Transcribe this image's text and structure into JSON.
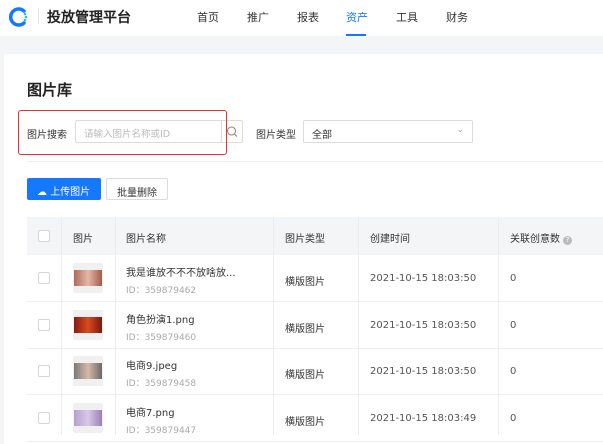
{
  "header": {
    "brand": "投放管理平台",
    "nav": [
      {
        "label": "首页"
      },
      {
        "label": "推广"
      },
      {
        "label": "报表"
      },
      {
        "label": "资产",
        "active": true
      },
      {
        "label": "工具"
      },
      {
        "label": "财务"
      }
    ]
  },
  "page": {
    "title": "图片库"
  },
  "filters": {
    "search_label": "图片搜索",
    "search_placeholder": "请输入图片名称或ID",
    "type_label": "图片类型",
    "type_value": "全部"
  },
  "actions": {
    "upload": "上传图片",
    "batch_delete": "批量删除"
  },
  "table": {
    "columns": [
      "图片",
      "图片名称",
      "图片类型",
      "创建时间",
      "关联创意数"
    ],
    "rows": [
      {
        "name": "我是谁放不不不放啥放...",
        "id": "ID：359879462",
        "type": "横版图片",
        "time": "2021-10-15 18:03:50",
        "count": "0"
      },
      {
        "name": "角色扮演1.png",
        "id": "ID：359879460",
        "type": "横版图片",
        "time": "2021-10-15 18:03:50",
        "count": "0"
      },
      {
        "name": "电商9.jpeg",
        "id": "ID：359879458",
        "type": "横版图片",
        "time": "2021-10-15 18:03:50",
        "count": "0"
      },
      {
        "name": "电商7.png",
        "id": "ID：359879447",
        "type": "横版图片",
        "time": "2021-10-15 18:03:49",
        "count": "0"
      }
    ]
  },
  "colors": {
    "accent": "#1677ff",
    "highlight": "#e8322d"
  }
}
